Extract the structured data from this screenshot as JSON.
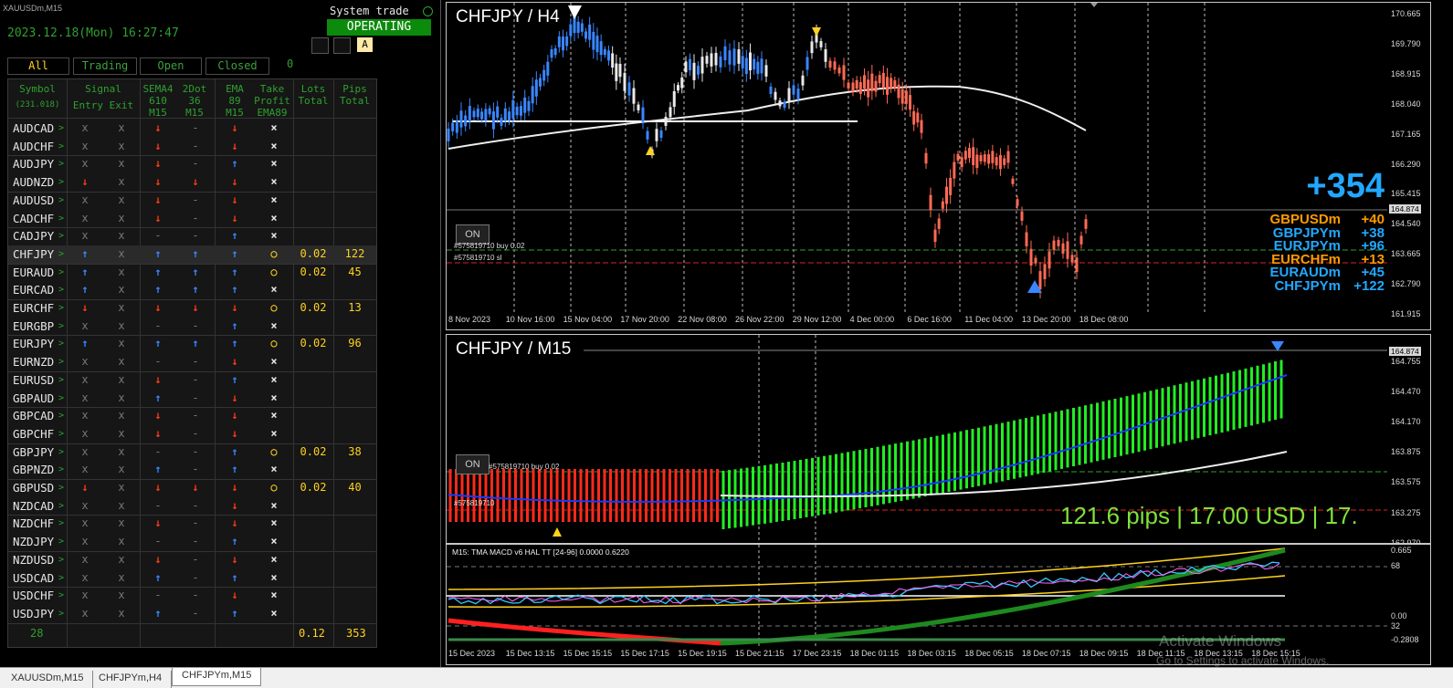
{
  "window_title": "XAUUSDm,M15",
  "datetime": "2023.12.18(Mon) 16:27:47",
  "system_trade_label": "System trade",
  "system_status": "OPERATING",
  "mode_button": "A",
  "filter_tabs": [
    "All",
    "Trading",
    "Open",
    "Closed"
  ],
  "open_count": "0",
  "table": {
    "headers": {
      "symbol": "Symbol",
      "symbol_sub": "(231.018)",
      "signal": "Signal",
      "entry": "Entry",
      "exit": "Exit",
      "sema": "SEMA4\n610\nM15",
      "twodot": "2Dot\n36\nM15",
      "ema": "EMA\n89\nM15",
      "tp": "Take\nProfit\nEMA89",
      "lots": "Lots\nTotal",
      "pips": "Pips\nTotal"
    },
    "rows": [
      {
        "sym": "AUDCAD",
        "entry": "x",
        "exit": "x",
        "sema": "down",
        "dot": "-",
        "ema": "down",
        "tp": "×",
        "lots": "",
        "pips": ""
      },
      {
        "sym": "AUDCHF",
        "entry": "x",
        "exit": "x",
        "sema": "down",
        "dot": "-",
        "ema": "down",
        "tp": "×",
        "lots": "",
        "pips": ""
      },
      {
        "sym": "AUDJPY",
        "entry": "x",
        "exit": "x",
        "sema": "down",
        "dot": "-",
        "ema": "up",
        "tp": "×",
        "lots": "",
        "pips": ""
      },
      {
        "sym": "AUDNZD",
        "entry": "down",
        "exit": "x",
        "sema": "down",
        "dot": "down",
        "ema": "down",
        "tp": "×",
        "lots": "",
        "pips": ""
      },
      {
        "sym": "AUDUSD",
        "entry": "x",
        "exit": "x",
        "sema": "down",
        "dot": "-",
        "ema": "down",
        "tp": "×",
        "lots": "",
        "pips": ""
      },
      {
        "sym": "CADCHF",
        "entry": "x",
        "exit": "x",
        "sema": "down",
        "dot": "-",
        "ema": "down",
        "tp": "×",
        "lots": "",
        "pips": ""
      },
      {
        "sym": "CADJPY",
        "entry": "x",
        "exit": "x",
        "sema": "-",
        "dot": "-",
        "ema": "up",
        "tp": "×",
        "lots": "",
        "pips": ""
      },
      {
        "sym": "CHFJPY",
        "entry": "up",
        "exit": "x",
        "sema": "up",
        "dot": "up",
        "ema": "up",
        "tp": "o",
        "lots": "0.02",
        "pips": "122"
      },
      {
        "sym": "EURAUD",
        "entry": "up",
        "exit": "x",
        "sema": "up",
        "dot": "up",
        "ema": "up",
        "tp": "o",
        "lots": "0.02",
        "pips": "45"
      },
      {
        "sym": "EURCAD",
        "entry": "up",
        "exit": "x",
        "sema": "up",
        "dot": "up",
        "ema": "up",
        "tp": "×",
        "lots": "",
        "pips": ""
      },
      {
        "sym": "EURCHF",
        "entry": "down",
        "exit": "x",
        "sema": "down",
        "dot": "down",
        "ema": "down",
        "tp": "o",
        "lots": "0.02",
        "pips": "13"
      },
      {
        "sym": "EURGBP",
        "entry": "x",
        "exit": "x",
        "sema": "-",
        "dot": "-",
        "ema": "up",
        "tp": "×",
        "lots": "",
        "pips": ""
      },
      {
        "sym": "EURJPY",
        "entry": "up",
        "exit": "x",
        "sema": "up",
        "dot": "up",
        "ema": "up",
        "tp": "o",
        "lots": "0.02",
        "pips": "96"
      },
      {
        "sym": "EURNZD",
        "entry": "x",
        "exit": "x",
        "sema": "-",
        "dot": "-",
        "ema": "down",
        "tp": "×",
        "lots": "",
        "pips": ""
      },
      {
        "sym": "EURUSD",
        "entry": "x",
        "exit": "x",
        "sema": "down",
        "dot": "-",
        "ema": "up",
        "tp": "×",
        "lots": "",
        "pips": ""
      },
      {
        "sym": "GBPAUD",
        "entry": "x",
        "exit": "x",
        "sema": "up",
        "dot": "-",
        "ema": "down",
        "tp": "×",
        "lots": "",
        "pips": ""
      },
      {
        "sym": "GBPCAD",
        "entry": "x",
        "exit": "x",
        "sema": "down",
        "dot": "-",
        "ema": "down",
        "tp": "×",
        "lots": "",
        "pips": ""
      },
      {
        "sym": "GBPCHF",
        "entry": "x",
        "exit": "x",
        "sema": "down",
        "dot": "-",
        "ema": "down",
        "tp": "×",
        "lots": "",
        "pips": ""
      },
      {
        "sym": "GBPJPY",
        "entry": "x",
        "exit": "x",
        "sema": "-",
        "dot": "-",
        "ema": "up",
        "tp": "o",
        "lots": "0.02",
        "pips": "38"
      },
      {
        "sym": "GBPNZD",
        "entry": "x",
        "exit": "x",
        "sema": "up",
        "dot": "-",
        "ema": "up",
        "tp": "×",
        "lots": "",
        "pips": ""
      },
      {
        "sym": "GBPUSD",
        "entry": "down",
        "exit": "x",
        "sema": "down",
        "dot": "down",
        "ema": "down",
        "tp": "o",
        "lots": "0.02",
        "pips": "40"
      },
      {
        "sym": "NZDCAD",
        "entry": "x",
        "exit": "x",
        "sema": "-",
        "dot": "-",
        "ema": "down",
        "tp": "×",
        "lots": "",
        "pips": ""
      },
      {
        "sym": "NZDCHF",
        "entry": "x",
        "exit": "x",
        "sema": "down",
        "dot": "-",
        "ema": "down",
        "tp": "×",
        "lots": "",
        "pips": ""
      },
      {
        "sym": "NZDJPY",
        "entry": "x",
        "exit": "x",
        "sema": "-",
        "dot": "-",
        "ema": "up",
        "tp": "×",
        "lots": "",
        "pips": ""
      },
      {
        "sym": "NZDUSD",
        "entry": "x",
        "exit": "x",
        "sema": "down",
        "dot": "-",
        "ema": "down",
        "tp": "×",
        "lots": "",
        "pips": ""
      },
      {
        "sym": "USDCAD",
        "entry": "x",
        "exit": "x",
        "sema": "up",
        "dot": "-",
        "ema": "up",
        "tp": "×",
        "lots": "",
        "pips": ""
      },
      {
        "sym": "USDCHF",
        "entry": "x",
        "exit": "x",
        "sema": "-",
        "dot": "-",
        "ema": "down",
        "tp": "×",
        "lots": "",
        "pips": ""
      },
      {
        "sym": "USDJPY",
        "entry": "x",
        "exit": "x",
        "sema": "up",
        "dot": "-",
        "ema": "up",
        "tp": "×",
        "lots": "",
        "pips": ""
      }
    ],
    "footer": {
      "count": "28",
      "lots": "0.12",
      "pips": "353"
    }
  },
  "chart_h4": {
    "title": "CHFJPY / H4",
    "price_labels": [
      "170.665",
      "169.790",
      "168.915",
      "168.040",
      "167.165",
      "166.290",
      "165.415",
      "164.540",
      "163.665",
      "162.790",
      "161.915"
    ],
    "current_price": "164.874",
    "time_labels": [
      "8 Nov 2023",
      "10 Nov 16:00",
      "15 Nov 04:00",
      "17 Nov 20:00",
      "22 Nov 08:00",
      "26 Nov 22:00",
      "29 Nov 12:00",
      "4 Dec 00:00",
      "6 Dec 16:00",
      "11 Dec 04:00",
      "13 Dec 20:00",
      "18 Dec 08:00"
    ],
    "on_button": "ON",
    "order_label_1": "#575819710 buy 0.02",
    "order_label_2": "#575819710 sl",
    "total_profit": "+354",
    "positions": [
      {
        "sym": "GBPUSDm",
        "pips": "+40",
        "color": "#ff9a00"
      },
      {
        "sym": "GBPJPYm",
        "pips": "+38",
        "color": "#22a8ff"
      },
      {
        "sym": "EURJPYm",
        "pips": "+96",
        "color": "#22a8ff"
      },
      {
        "sym": "EURCHFm",
        "pips": "+13",
        "color": "#ff9a00"
      },
      {
        "sym": "EURAUDm",
        "pips": "+45",
        "color": "#22a8ff"
      },
      {
        "sym": "CHFJPYm",
        "pips": "+122",
        "color": "#22a8ff"
      }
    ]
  },
  "chart_m15": {
    "title": "CHFJPY / M15",
    "price_labels": [
      "164.874",
      "164.755",
      "164.470",
      "164.170",
      "163.875",
      "163.575",
      "163.275",
      "162.970"
    ],
    "current_price": "164.874",
    "on_button": "ON",
    "order_label_1": "#575819710 buy 0.02",
    "order_label_2": "#575819710",
    "pl_text": "121.6 pips | 17.00 USD | 17.",
    "macd_title": "M15: TMA MACD v6 HAL TT [24-96] 0.0000 0.6220",
    "macd_labels": [
      "0.665",
      "68",
      "0.00",
      "32",
      "-0.2808"
    ],
    "time_labels": [
      "15 Dec 2023",
      "15 Dec 13:15",
      "15 Dec 15:15",
      "15 Dec 17:15",
      "15 Dec 19:15",
      "15 Dec 21:15",
      "17 Dec 23:15",
      "18 Dec 01:15",
      "18 Dec 03:15",
      "18 Dec 05:15",
      "18 Dec 07:15",
      "18 Dec 09:15",
      "18 Dec 11:15",
      "18 Dec 13:15",
      "18 Dec 15:15"
    ]
  },
  "watermark": {
    "line1": "Activate Windows",
    "line2": "Go to Settings to activate Windows."
  },
  "bottom_tabs": [
    "XAUUSDm,M15",
    "CHFJPYm,H4",
    "CHFJPYm,M15"
  ]
}
